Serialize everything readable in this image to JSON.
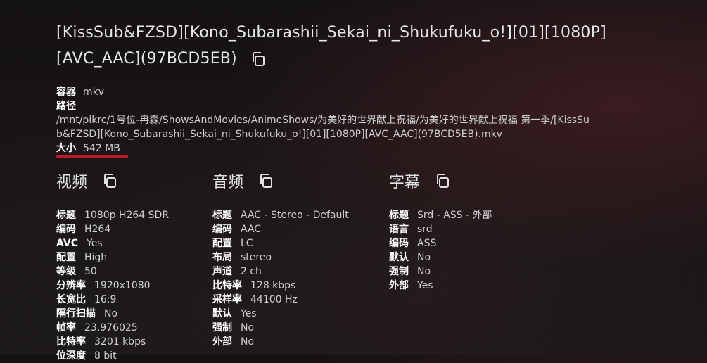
{
  "title": "[KissSub&FZSD][Kono_Subarashii_Sekai_ni_Shukufuku_o!][01][1080P][AVC_AAC](97BCD5EB)",
  "meta": {
    "container_label": "容器",
    "container_value": "mkv",
    "path_label": "路径",
    "path_value": "/mnt/pikrc/1号位-冉森/ShowsAndMovies/AnimeShows/为美好的世界献上祝福/为美好的世界献上祝福 第一季/[KissSub&FZSD][Kono_Subarashii_Sekai_ni_Shukufuku_o!][01][1080P][AVC_AAC](97BCD5EB).mkv",
    "size_label": "大小",
    "size_value": "542 MB"
  },
  "video": {
    "title": "视频",
    "rows": [
      {
        "label": "标题",
        "value": "1080p H264 SDR"
      },
      {
        "label": "编码",
        "value": "H264"
      },
      {
        "label": "AVC",
        "value": "Yes"
      },
      {
        "label": "配置",
        "value": "High"
      },
      {
        "label": "等级",
        "value": "50"
      },
      {
        "label": "分辨率",
        "value": "1920x1080"
      },
      {
        "label": "长宽比",
        "value": "16:9"
      },
      {
        "label": "隔行扫描",
        "value": "No"
      },
      {
        "label": "帧率",
        "value": "23.976025"
      },
      {
        "label": "比特率",
        "value": "3201 kbps"
      },
      {
        "label": "位深度",
        "value": "8 bit"
      }
    ]
  },
  "audio": {
    "title": "音频",
    "rows": [
      {
        "label": "标题",
        "value": "AAC - Stereo - Default"
      },
      {
        "label": "编码",
        "value": "AAC"
      },
      {
        "label": "配置",
        "value": "LC"
      },
      {
        "label": "布局",
        "value": "stereo"
      },
      {
        "label": "声道",
        "value": "2 ch"
      },
      {
        "label": "比特率",
        "value": "128 kbps"
      },
      {
        "label": "采样率",
        "value": "44100 Hz"
      },
      {
        "label": "默认",
        "value": "Yes"
      },
      {
        "label": "强制",
        "value": "No"
      },
      {
        "label": "外部",
        "value": "No"
      }
    ]
  },
  "subtitle": {
    "title": "字幕",
    "rows": [
      {
        "label": "标题",
        "value": "Srd - ASS - 外部"
      },
      {
        "label": "语言",
        "value": "srd"
      },
      {
        "label": "编码",
        "value": "ASS"
      },
      {
        "label": "默认",
        "value": "No"
      },
      {
        "label": "强制",
        "value": "No"
      },
      {
        "label": "外部",
        "value": "Yes"
      }
    ]
  },
  "icons": {
    "copy": "copy-icon"
  },
  "colors": {
    "accent_underline": "#c01828",
    "background": "#171314",
    "text": "#d8d8d8"
  }
}
